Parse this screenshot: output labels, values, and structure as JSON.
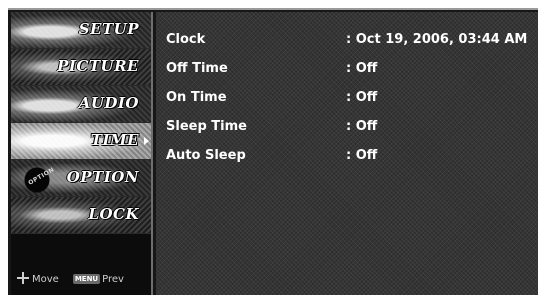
{
  "sidebar": {
    "items": [
      {
        "label": "SETUP",
        "icon": "setup-art-icon"
      },
      {
        "label": "PICTURE",
        "icon": "picture-art-icon"
      },
      {
        "label": "AUDIO",
        "icon": "audio-art-icon"
      },
      {
        "label": "TIME",
        "icon": "time-art-icon",
        "active": true
      },
      {
        "label": "OPTION",
        "icon": "option-art-icon",
        "badge": "OPTION"
      },
      {
        "label": "LOCK",
        "icon": "lock-art-icon"
      }
    ],
    "footer": {
      "move_label": "Move",
      "menu_key": "MENU",
      "prev_label": "Prev"
    }
  },
  "time_settings": {
    "rows": [
      {
        "label": "Clock",
        "value": ": Oct 19, 2006, 03:44 AM"
      },
      {
        "label": "Off Time",
        "value": ": Off"
      },
      {
        "label": "On Time",
        "value": ": Off"
      },
      {
        "label": "Sleep Time",
        "value": ": Off"
      },
      {
        "label": "Auto Sleep",
        "value": ": Off"
      }
    ]
  }
}
